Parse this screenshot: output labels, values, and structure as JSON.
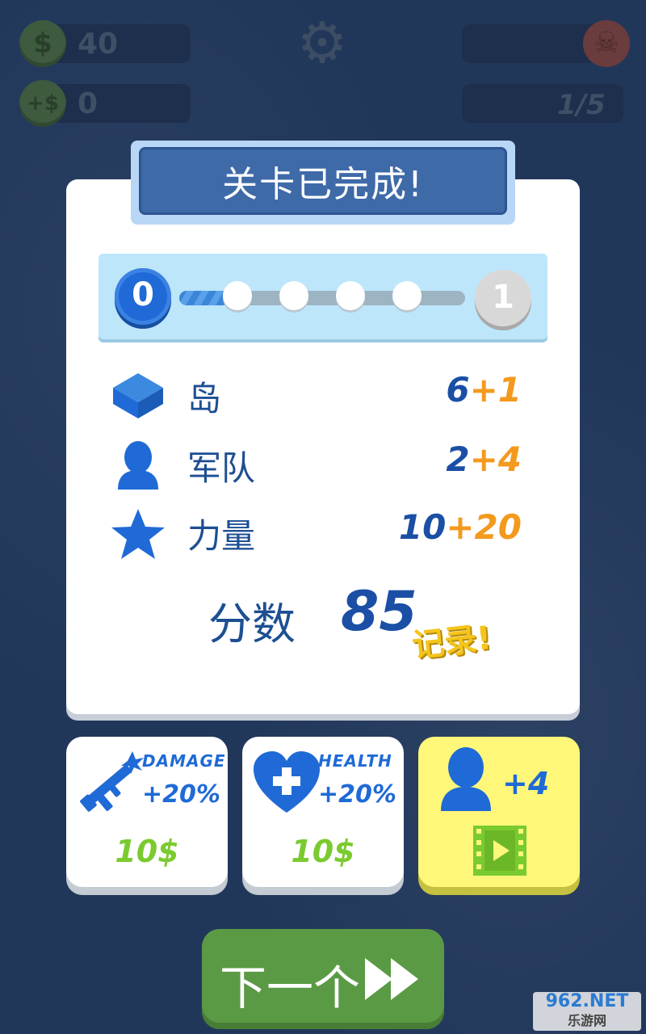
{
  "hud": {
    "money_symbol": "$",
    "money": "40",
    "income_symbol": "+$",
    "income": "0",
    "wave": "1/5"
  },
  "title": "关卡已完成!",
  "progress": {
    "current_level": "0",
    "next_level": "1",
    "fill_fraction": 0.18
  },
  "stats": [
    {
      "label": "岛",
      "base": "6",
      "bonus": "+1",
      "icon": "island-icon"
    },
    {
      "label": "军队",
      "base": "2",
      "bonus": "+4",
      "icon": "person-icon"
    },
    {
      "label": "力量",
      "base": "10",
      "bonus": "+20",
      "icon": "star-icon"
    }
  ],
  "score": {
    "label": "分数",
    "value": "85",
    "record": "记录!"
  },
  "upgrades": [
    {
      "name": "DAMAGE",
      "amount": "+20%",
      "price": "10$",
      "icon": "rifle-icon"
    },
    {
      "name": "HEALTH",
      "amount": "+20%",
      "price": "10$",
      "icon": "heart-plus-icon"
    },
    {
      "name": "",
      "amount": "+4",
      "price": "",
      "icon": "video-ad-icon"
    }
  ],
  "next_button": {
    "label": "下一个",
    "icon": "fast-forward-icon"
  },
  "watermark": {
    "line1": "962.NET",
    "line2": "乐游网"
  },
  "colors": {
    "accent": "#1f6ad6",
    "bonus": "#f39a1e",
    "price": "#7acb2f",
    "next_button": "#5a9a45"
  }
}
